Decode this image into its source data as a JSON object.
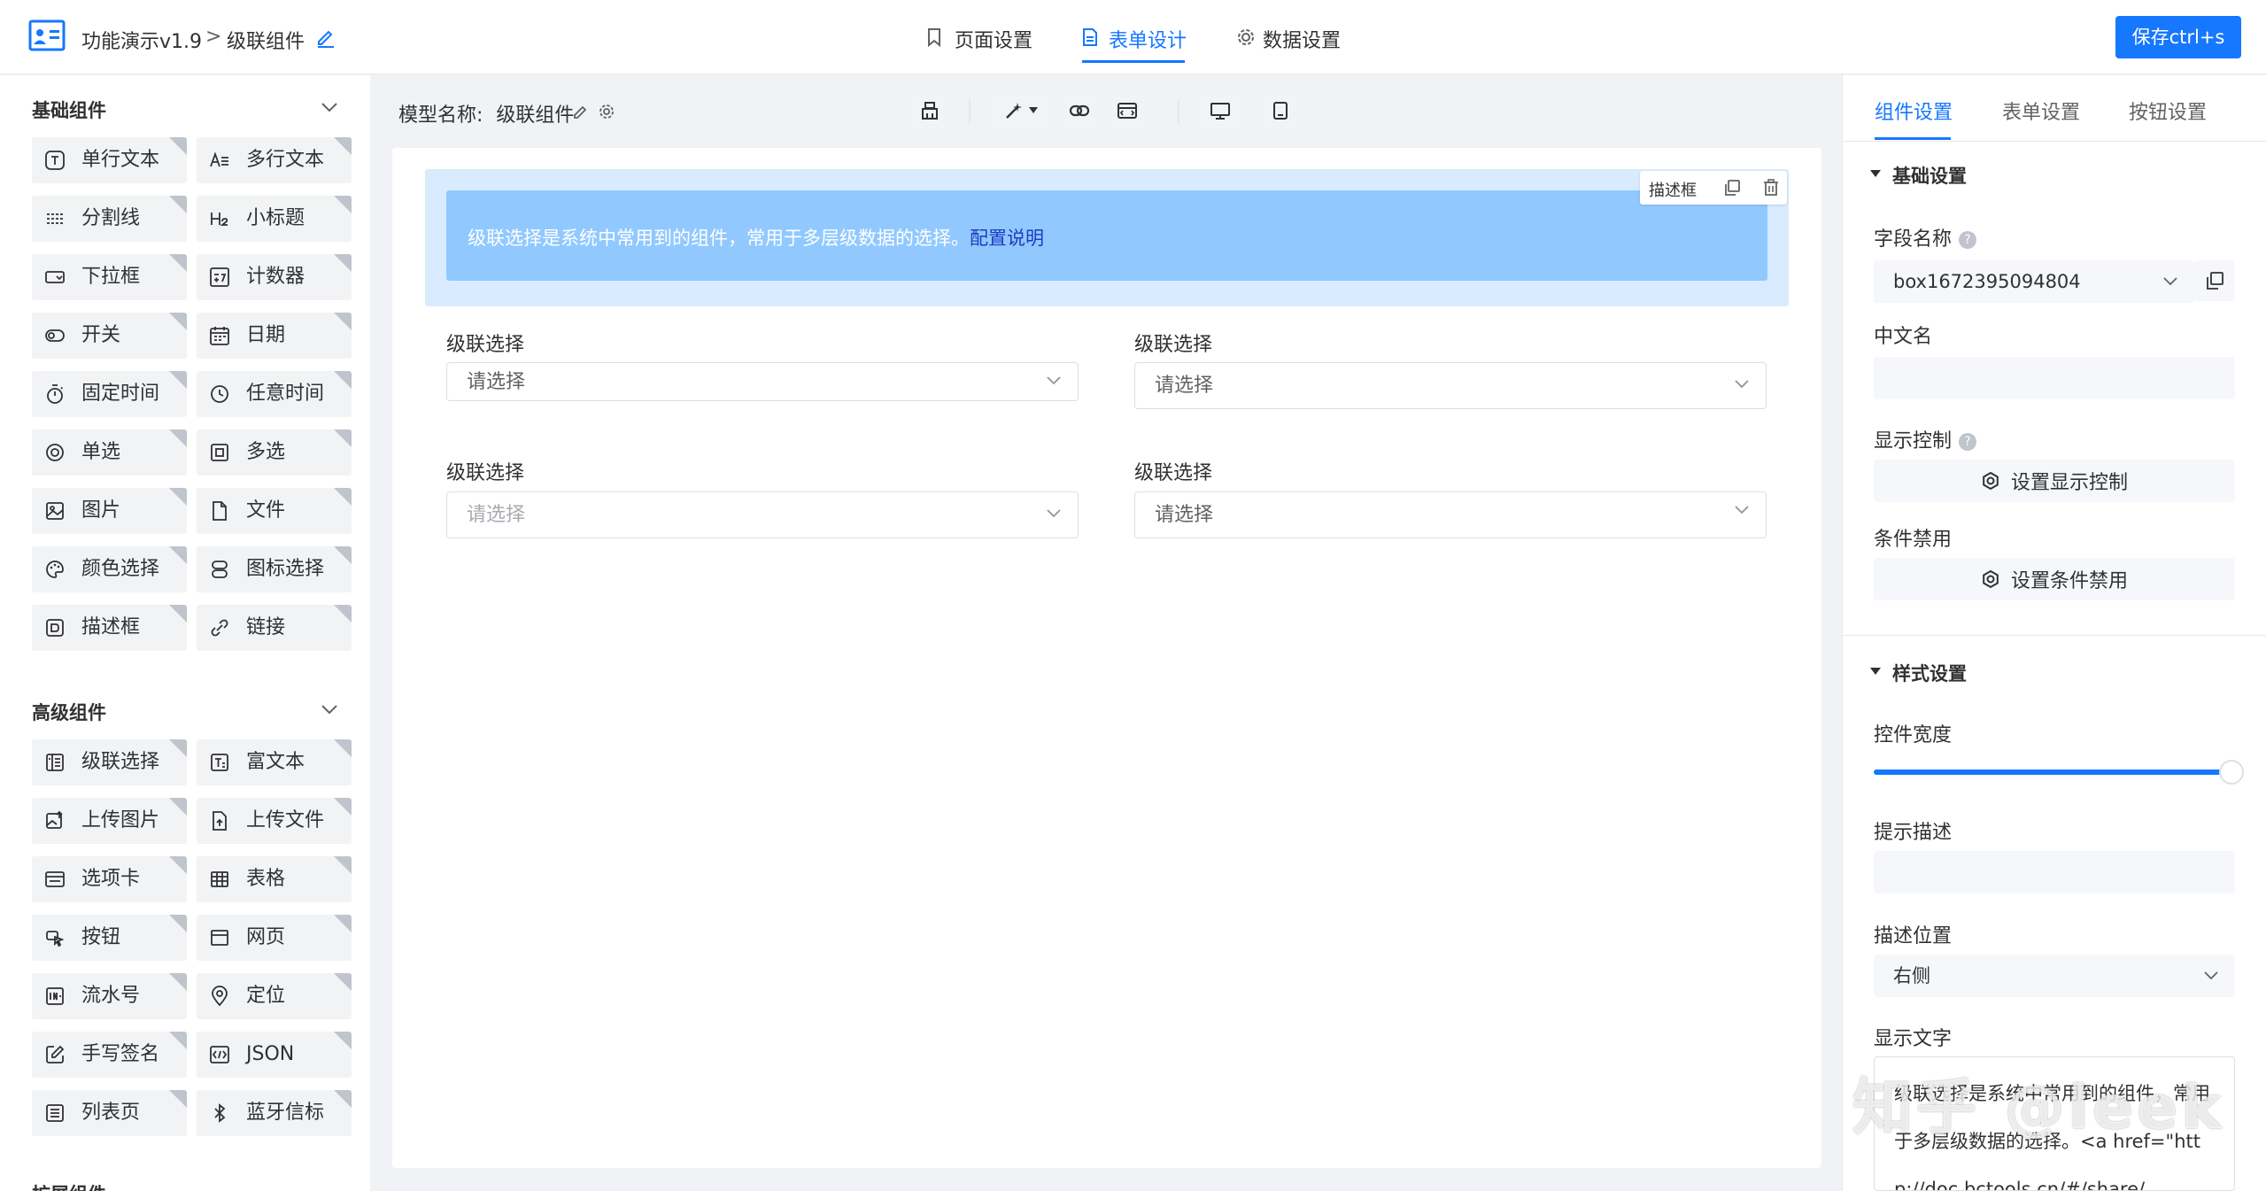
{
  "header": {
    "app_name": "功能演示v1.9",
    "breadcrumb_sep": ">",
    "page_name": "级联组件",
    "tabs": [
      {
        "label": "页面设置",
        "active": false
      },
      {
        "label": "表单设计",
        "active": true
      },
      {
        "label": "数据设置",
        "active": false
      }
    ],
    "save_label": "保存ctrl+s"
  },
  "colors": {
    "accent": "#1677ff",
    "alert_bg": "#91c9ff",
    "alert_wrap": "#d9ebff"
  },
  "left": {
    "basic_title": "基础组件",
    "basic": [
      {
        "label": "单行文本",
        "icon": "text-t-icon"
      },
      {
        "label": "多行文本",
        "icon": "text-multi-icon"
      },
      {
        "label": "分割线",
        "icon": "divider-icon"
      },
      {
        "label": "小标题",
        "icon": "heading-icon"
      },
      {
        "label": "下拉框",
        "icon": "dropdown-icon"
      },
      {
        "label": "计数器",
        "icon": "counter-icon"
      },
      {
        "label": "开关",
        "icon": "toggle-icon"
      },
      {
        "label": "日期",
        "icon": "calendar-icon"
      },
      {
        "label": "固定时间",
        "icon": "stopwatch-icon"
      },
      {
        "label": "任意时间",
        "icon": "clock-icon"
      },
      {
        "label": "单选",
        "icon": "radio-icon"
      },
      {
        "label": "多选",
        "icon": "checkbox-icon"
      },
      {
        "label": "图片",
        "icon": "image-icon"
      },
      {
        "label": "文件",
        "icon": "file-icon"
      },
      {
        "label": "颜色选择",
        "icon": "palette-icon"
      },
      {
        "label": "图标选择",
        "icon": "icon-select-icon"
      },
      {
        "label": "描述框",
        "icon": "description-icon"
      },
      {
        "label": "链接",
        "icon": "link-icon"
      }
    ],
    "advanced_title": "高级组件",
    "advanced": [
      {
        "label": "级联选择",
        "icon": "cascade-icon"
      },
      {
        "label": "富文本",
        "icon": "richtext-icon"
      },
      {
        "label": "上传图片",
        "icon": "upload-image-icon"
      },
      {
        "label": "上传文件",
        "icon": "upload-file-icon"
      },
      {
        "label": "选项卡",
        "icon": "tabs-icon"
      },
      {
        "label": "表格",
        "icon": "table-icon"
      },
      {
        "label": "按钮",
        "icon": "button-icon"
      },
      {
        "label": "网页",
        "icon": "webpage-icon"
      },
      {
        "label": "流水号",
        "icon": "serial-icon"
      },
      {
        "label": "定位",
        "icon": "location-icon"
      },
      {
        "label": "手写签名",
        "icon": "signature-icon"
      },
      {
        "label": "JSON",
        "icon": "json-icon"
      },
      {
        "label": "列表页",
        "icon": "list-icon"
      },
      {
        "label": "蓝牙信标",
        "icon": "bluetooth-icon"
      }
    ],
    "cut_title": "扩展组件"
  },
  "model": {
    "prefix": "模型名称:",
    "name": "级联组件"
  },
  "canvas": {
    "desc_toolbar_label": "描述框",
    "alert_text": "级联选择是系统中常用到的组件，常用于多层级数据的选择。",
    "alert_link": "配置说明",
    "fields": [
      {
        "label": "级联选择",
        "placeholder": "请选择"
      },
      {
        "label": "级联选择",
        "placeholder": "请选择"
      },
      {
        "label": "级联选择",
        "placeholder": "请选择"
      },
      {
        "label": "级联选择",
        "placeholder": "请选择"
      }
    ]
  },
  "right": {
    "tabs": [
      {
        "label": "组件设置",
        "active": true
      },
      {
        "label": "表单设置",
        "active": false
      },
      {
        "label": "按钮设置",
        "active": false
      }
    ],
    "basic_section": "基础设置",
    "field_name_label": "字段名称",
    "field_name_value": "box1672395094804",
    "cn_name_label": "中文名",
    "display_ctrl_label": "显示控制",
    "display_ctrl_btn": "设置显示控制",
    "cond_disable_label": "条件禁用",
    "cond_disable_btn": "设置条件禁用",
    "style_section": "样式设置",
    "width_label": "控件宽度",
    "width_percent": 100,
    "hint_label": "提示描述",
    "desc_pos_label": "描述位置",
    "desc_pos_value": "右侧",
    "display_text_label": "显示文字",
    "display_text_value": "级联选择是系统中常用到的组件，常用于多层级数据的选择。<a href=\"http://doc.bctools.cn/#/share/"
  },
  "watermark": "知乎 @leek"
}
